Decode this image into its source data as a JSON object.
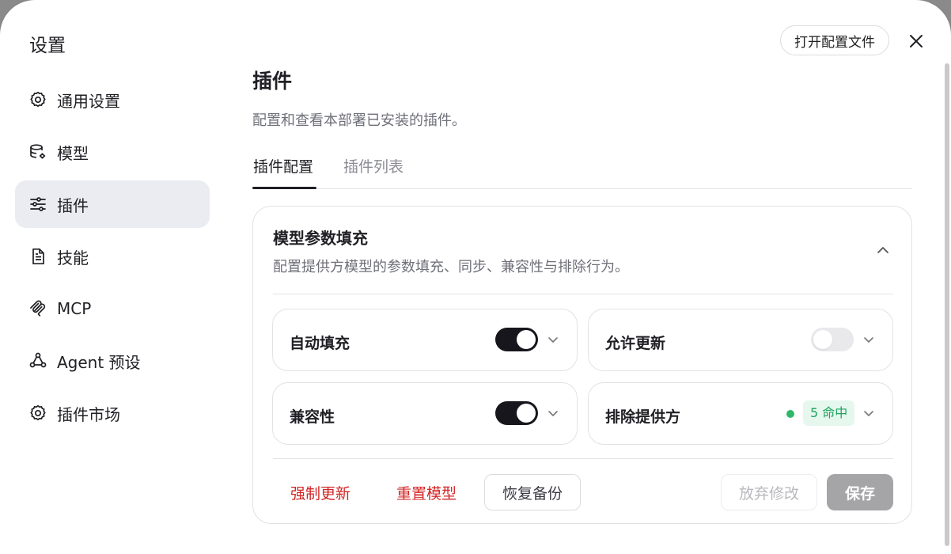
{
  "dialog": {
    "title": "设置",
    "open_config_label": "打开配置文件",
    "close_icon": "close-icon"
  },
  "sidebar": {
    "items": [
      {
        "label": "通用设置",
        "icon": "gear-icon",
        "active": false
      },
      {
        "label": "模型",
        "icon": "database-settings-icon",
        "active": false
      },
      {
        "label": "插件",
        "icon": "sliders-icon",
        "active": true
      },
      {
        "label": "技能",
        "icon": "document-icon",
        "active": false
      },
      {
        "label": "MCP",
        "icon": "mcp-icon",
        "active": false
      },
      {
        "label": "Agent 预设",
        "icon": "agent-network-icon",
        "active": false
      },
      {
        "label": "插件市场",
        "icon": "gear-icon",
        "active": false
      }
    ]
  },
  "main": {
    "title": "插件",
    "description": "配置和查看本部署已安装的插件。",
    "tabs": [
      {
        "label": "插件配置",
        "active": true
      },
      {
        "label": "插件列表",
        "active": false
      }
    ],
    "card": {
      "title": "模型参数填充",
      "description": "配置提供方模型的参数填充、同步、兼容性与排除行为。",
      "options": [
        {
          "label": "自动填充",
          "enabled": true
        },
        {
          "label": "允许更新",
          "enabled": false
        },
        {
          "label": "兼容性",
          "enabled": true
        },
        {
          "label": "排除提供方",
          "badge": "5 命中"
        }
      ],
      "actions": {
        "force_update": "强制更新",
        "reset_model": "重置模型",
        "restore_backup": "恢复备份",
        "discard": "放弃修改",
        "save": "保存"
      }
    }
  },
  "colors": {
    "danger": "#d32626",
    "toggle_on": "#16161c",
    "toggle_off": "#e9e9ec",
    "badge_green": "#1ea45e",
    "active_nav_bg": "#eaecf1"
  }
}
